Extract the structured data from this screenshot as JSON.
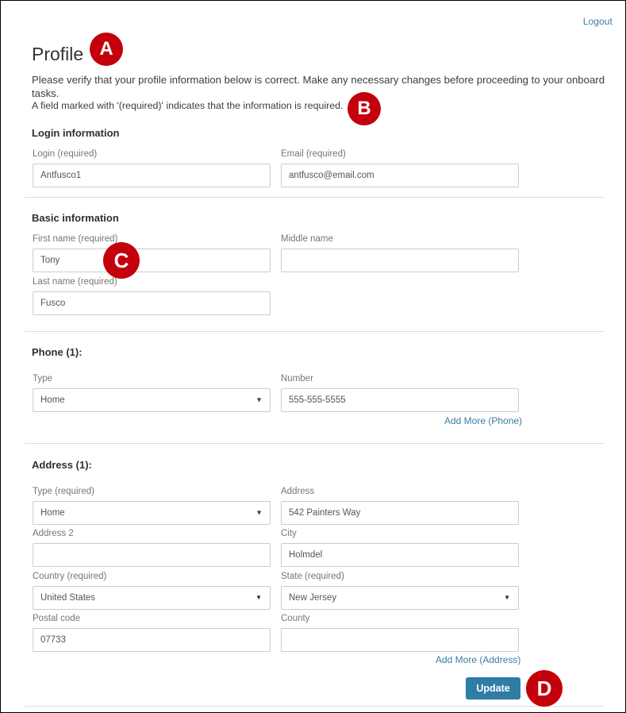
{
  "header": {
    "logout_label": "Logout",
    "title": "Profile",
    "intro_line_1": "Please verify that your profile information below is correct. Make any necessary changes before proceeding to your onboard tasks.",
    "intro_line_2": "A field marked with '(required)' indicates that the information is required."
  },
  "sections": {
    "login": {
      "heading": "Login information",
      "fields": {
        "login": {
          "label": "Login (required)",
          "value": "Antfusco1"
        },
        "email": {
          "label": "Email (required)",
          "value": "antfusco@email.com"
        }
      }
    },
    "basic": {
      "heading": "Basic information",
      "fields": {
        "first_name": {
          "label": "First name (required)",
          "value": "Tony"
        },
        "middle_name": {
          "label": "Middle name",
          "value": ""
        },
        "last_name": {
          "label": "Last name (required)",
          "value": "Fusco"
        }
      }
    },
    "phone": {
      "heading": "Phone (1):",
      "add_more_label": "Add More (Phone)",
      "fields": {
        "type": {
          "label": "Type",
          "value": "Home"
        },
        "number": {
          "label": "Number",
          "value": "555-555-5555"
        }
      }
    },
    "address": {
      "heading": "Address (1):",
      "add_more_label": "Add More (Address)",
      "fields": {
        "type": {
          "label": "Type (required)",
          "value": "Home"
        },
        "address": {
          "label": "Address",
          "value": "542 Painters Way"
        },
        "address2": {
          "label": "Address 2",
          "value": ""
        },
        "city": {
          "label": "City",
          "value": "Holmdel"
        },
        "country": {
          "label": "Country (required)",
          "value": "United States"
        },
        "state": {
          "label": "State (required)",
          "value": "New Jersey"
        },
        "postal": {
          "label": "Postal code",
          "value": "07733"
        },
        "county": {
          "label": "County",
          "value": ""
        }
      }
    }
  },
  "footer": {
    "update_label": "Update"
  },
  "annotations": [
    {
      "letter": "A"
    },
    {
      "letter": "B"
    },
    {
      "letter": "C"
    },
    {
      "letter": "D"
    }
  ],
  "icons": {
    "caret_down": "▼",
    "caret_down_native": "▼"
  },
  "colors": {
    "badge_red": "#c4000c",
    "link_blue": "#3a7ca5",
    "button_blue": "#2f7ca5",
    "border_gray": "#cccccc",
    "divider_gray": "#dcdcdc"
  }
}
